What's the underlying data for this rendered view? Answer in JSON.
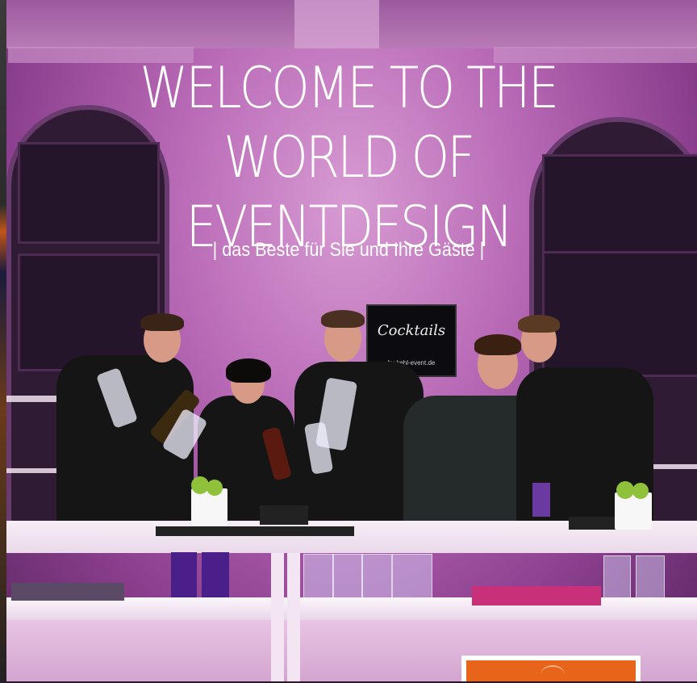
{
  "hero": {
    "title": "WELCOME TO THE WORLD OF EVENTDESIGN",
    "subtitle": "| das Beste für Sie und Ihre Gäste |"
  },
  "sign": {
    "logo_text": "Cocktails",
    "url_text": "by kehl-event.de"
  },
  "colors": {
    "accent_orange": "#e8641a",
    "overlay_purple": "#b96ab6"
  }
}
